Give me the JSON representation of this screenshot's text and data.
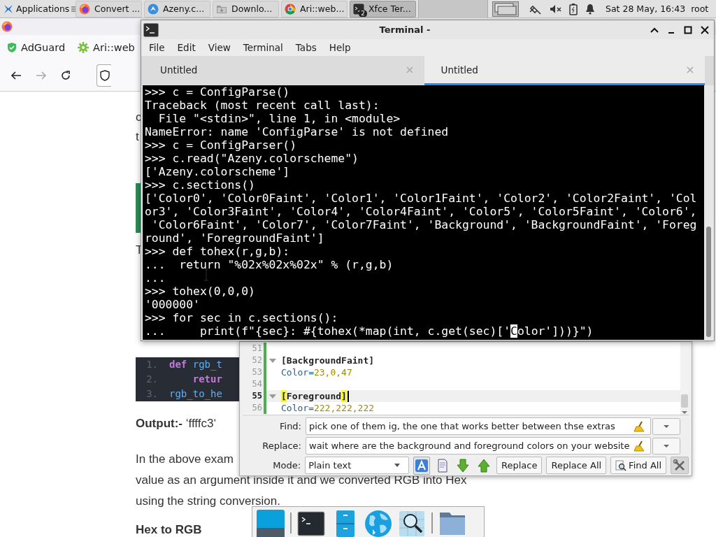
{
  "panel": {
    "apps_label": "Applications",
    "tasks": [
      {
        "label": "Convert ...",
        "kind": "firefox",
        "selected": false
      },
      {
        "label": "Azeny.c...",
        "kind": "azeny",
        "selected": false
      },
      {
        "label": "Downlo...",
        "kind": "folder",
        "selected": false
      },
      {
        "label": "Ari::web...",
        "kind": "chrome",
        "selected": false
      },
      {
        "label": "Xfce Ter...",
        "kind": "terminal",
        "badge": "2",
        "selected": true
      }
    ],
    "clock": "Sat 28 May, 16:43",
    "user": "root"
  },
  "browser": {
    "bookmarks": [
      {
        "label": "AdGuard",
        "kind": "shield"
      },
      {
        "label": "Ari::web",
        "kind": "gear"
      }
    ],
    "article": [
      {
        "kind": "fragments",
        "lines": [
          "c",
          "t"
        ]
      },
      {
        "kind": "callout"
      },
      {
        "kind": "fragments2",
        "lines": [
          "T"
        ]
      },
      {
        "kind": "code",
        "lines": [
          {
            "number": "1.",
            "tokens": [
              {
                "text": "def",
                "kind": "keyword"
              },
              {
                "text": "rgb_t",
                "kind": "name"
              }
            ]
          },
          {
            "number": "2.",
            "tokens": [
              {
                "text": "    retur",
                "kind": "keyword"
              }
            ]
          },
          {
            "number": "3.",
            "tokens": [
              {
                "text": "rgb_to_he",
                "kind": "name"
              }
            ]
          }
        ]
      },
      {
        "kind": "output",
        "text": "**Output:-** ‘ffffc3‘"
      },
      {
        "kind": "paragraph",
        "lines": [
          "In the above exam",
          "value as an argument inside it and we converted RGB into Hex",
          "using the string conversion."
        ]
      },
      {
        "kind": "heading2",
        "text": "Hex to RGB"
      }
    ]
  },
  "terminal": {
    "title": "Terminal -",
    "menu": [
      "File",
      "Edit",
      "View",
      "Terminal",
      "Tabs",
      "Help"
    ],
    "tabs": [
      {
        "label": "Untitled",
        "selected": false
      },
      {
        "label": "Untitled",
        "selected": true
      }
    ],
    "lines": [
      {
        "text": ">>> c = ConfigParse()"
      },
      {
        "text": "Traceback (most recent call last):"
      },
      {
        "text": "  File \"<stdin>\", line 1, in <module>"
      },
      {
        "text": "NameError: name 'ConfigParse' is not defined"
      },
      {
        "text": ">>> c = ConfigParser()"
      },
      {
        "text": ">>> c.read(\"Azeny.colorscheme\")"
      },
      {
        "text": "['Azeny.colorscheme']"
      },
      {
        "text": ">>> c.sections()"
      },
      {
        "text": "['Color0', 'Color0Faint', 'Color1', 'Color1Faint', 'Color2', 'Color2Faint', 'Col"
      },
      {
        "text": "or3', 'Color3Faint', 'Color4', 'Color4Faint', 'Color5', 'Color5Faint', 'Color6',"
      },
      {
        "text": " 'Color6Faint', 'Color7', 'Color7Faint', 'Background', 'BackgroundFaint', 'Foreg"
      },
      {
        "text": "round', 'ForegroundFaint']"
      },
      {
        "text": ">>> def tohex(r,g,b):"
      },
      {
        "text": "...  return \"%02x%02x%02x\" % (r,g,b)"
      },
      {
        "text": "..."
      },
      {
        "text": ">>> tohex(0,0,0)"
      },
      {
        "text": "'000000'"
      },
      {
        "text": ">>> for sec in c.sections():"
      },
      {
        "text": "...     print(f\"{sec}: #{tohex(*map(int, c.get(sec)['",
        "cursor": "C",
        "after": "olor']))}\")"
      }
    ]
  },
  "editor": {
    "lines": [
      {
        "number": "51",
        "kind": "blank",
        "current": false
      },
      {
        "number": "52",
        "kind": "section",
        "text": "[BackgroundFaint]",
        "current": false
      },
      {
        "number": "53",
        "kind": "pair",
        "key": "Color=",
        "value": "23,0,47",
        "current": false
      },
      {
        "number": "54",
        "kind": "blank",
        "current": false
      },
      {
        "number": "55",
        "kind": "section",
        "text": "[Foreground]",
        "current": true
      },
      {
        "number": "56",
        "kind": "pair",
        "key": "Color=",
        "value": "222,222,222",
        "current": false
      }
    ],
    "find": {
      "label": "Find:",
      "value": "pick one of them ig, the one that works better between thse extras"
    },
    "replace": {
      "label": "Replace:",
      "value": "wait where are the background and foreground colors on your website"
    },
    "mode": {
      "label": "Mode:",
      "value": "Plain text"
    },
    "tool_buttons": [
      {
        "kind": "case",
        "on": true
      },
      {
        "kind": "document",
        "on": false
      },
      {
        "kind": "down",
        "on": false
      },
      {
        "kind": "up",
        "on": false
      }
    ],
    "buttons": [
      {
        "kind": "text",
        "label": "Replace"
      },
      {
        "kind": "text",
        "label": "Replace All"
      },
      {
        "kind": "search",
        "label": "Find All"
      },
      {
        "kind": "tools"
      }
    ]
  },
  "dock": {
    "items": [
      {
        "kind": "desktop"
      },
      {
        "kind": "separator"
      },
      {
        "kind": "terminal"
      },
      {
        "kind": "cabinet"
      },
      {
        "kind": "globe"
      },
      {
        "kind": "search"
      },
      {
        "kind": "separator"
      },
      {
        "kind": "folder"
      }
    ]
  }
}
